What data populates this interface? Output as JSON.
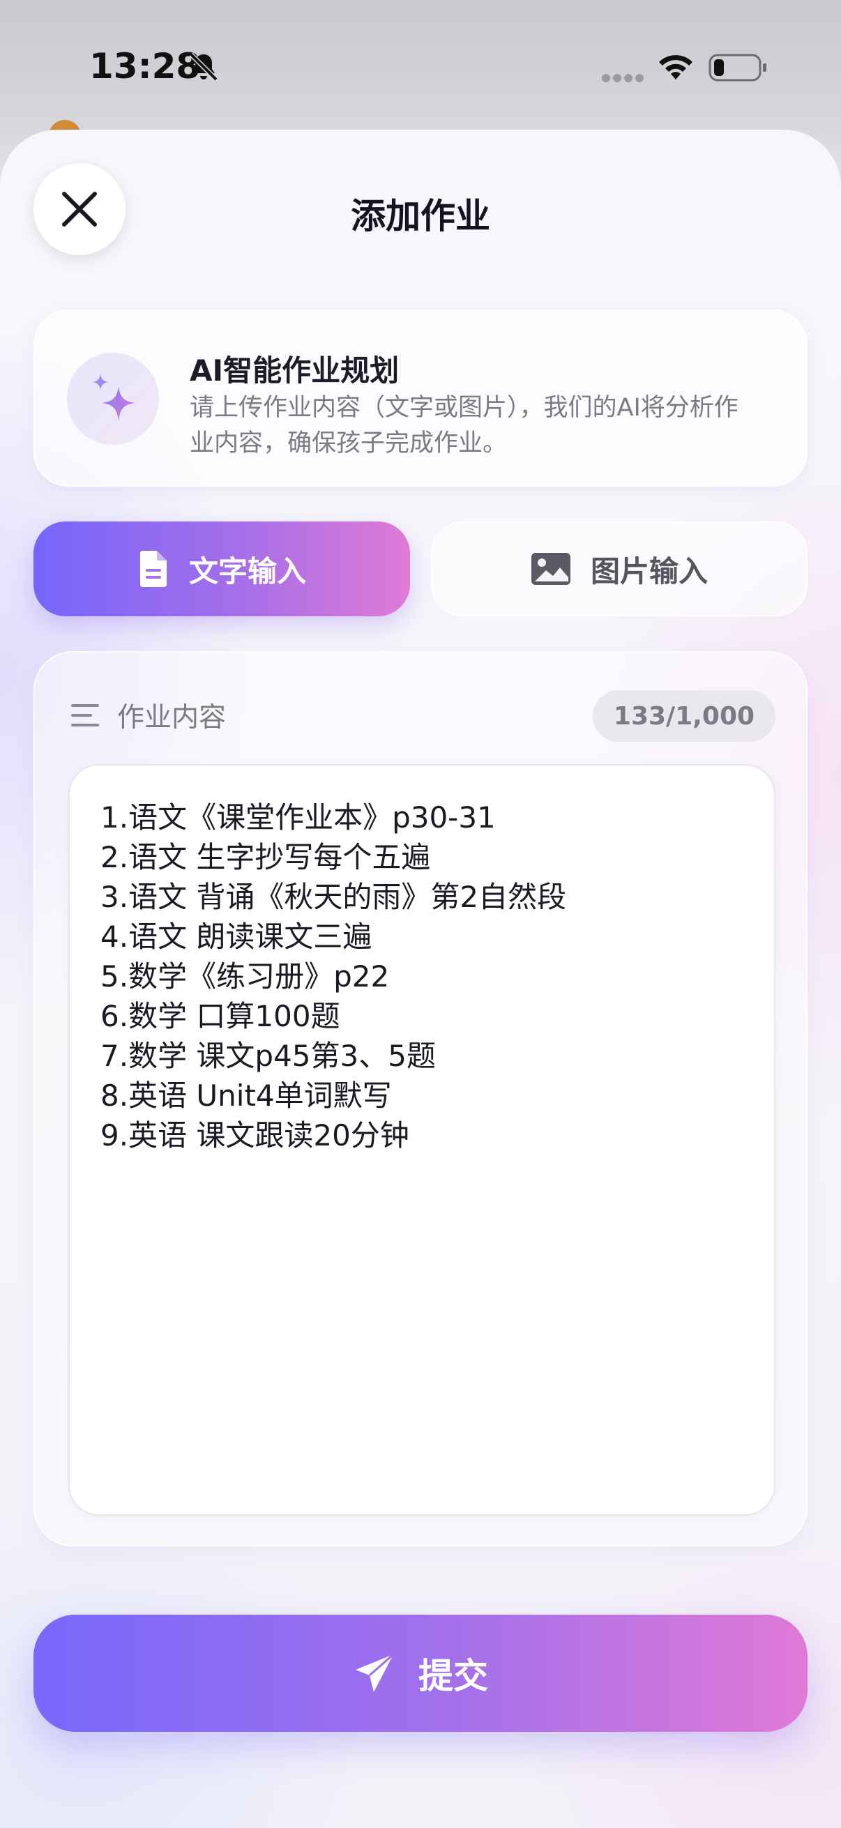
{
  "status_bar": {
    "time": "13:28",
    "icons": [
      "bell-off-icon",
      "signal-dots-icon",
      "wifi-icon",
      "battery-icon"
    ]
  },
  "sheet": {
    "title": "添加作业",
    "close_icon": "close-icon"
  },
  "info_card": {
    "icon": "sparkle-icon",
    "title": "AI智能作业规划",
    "description": "请上传作业内容（文字或图片），我们的AI将分析作业内容，确保孩子完成作业。"
  },
  "mode_toggle": {
    "text_mode_label": "文字输入",
    "text_mode_icon": "document-icon",
    "image_mode_label": "图片输入",
    "image_mode_icon": "image-icon",
    "selected": "text",
    "active_gradient": [
      "#7665fb",
      "#e07ad6"
    ]
  },
  "content": {
    "label": "作业内容",
    "label_icon": "lines-icon",
    "counter": "133/1,000",
    "text": "1.语文《课堂作业本》p30-31\n2.语文 生字抄写每个五遍\n3.语文 背诵《秋天的雨》第2自然段\n4.语文 朗读课文三遍\n5.数学《练习册》p22\n6.数学 口算100题\n7.数学 课文p45第3、5题\n8.英语 Unit4单词默写\n9.英语 课文跟读20分钟"
  },
  "submit": {
    "label": "提交",
    "icon": "send-icon"
  }
}
